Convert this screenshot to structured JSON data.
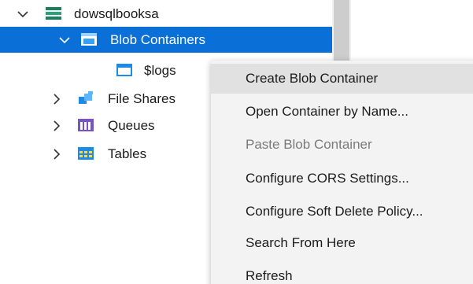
{
  "tree": {
    "items": [
      {
        "label": "dowsqlbooksa",
        "icon": "storage-account-icon",
        "expanded": true,
        "selected": false
      },
      {
        "label": "Blob Containers",
        "icon": "blob-container-icon",
        "expanded": true,
        "selected": true
      },
      {
        "label": "$logs",
        "icon": "container-icon",
        "selected": false
      },
      {
        "label": "File Shares",
        "icon": "file-share-icon",
        "expanded": false,
        "selected": false
      },
      {
        "label": "Queues",
        "icon": "queue-icon",
        "expanded": false,
        "selected": false
      },
      {
        "label": "Tables",
        "icon": "table-icon",
        "expanded": false,
        "selected": false
      }
    ]
  },
  "context_menu": {
    "items": [
      {
        "label": "Create Blob Container",
        "state": "highlighted"
      },
      {
        "label": "Open Container by Name...",
        "state": "enabled"
      },
      {
        "label": "Paste Blob Container",
        "state": "disabled"
      },
      {
        "label": "Configure CORS Settings...",
        "state": "enabled"
      },
      {
        "label": "Configure Soft Delete Policy...",
        "state": "enabled"
      },
      {
        "label": "Search From Here",
        "state": "enabled"
      },
      {
        "label": "Refresh",
        "state": "enabled"
      }
    ]
  },
  "colors": {
    "selection": "#0a6fd6",
    "menu_background": "#f3f3f3",
    "menu_highlight": "#e1e1e1",
    "disabled_text": "#7a7a7a",
    "scrollbar_thumb": "#cdcdcd"
  }
}
